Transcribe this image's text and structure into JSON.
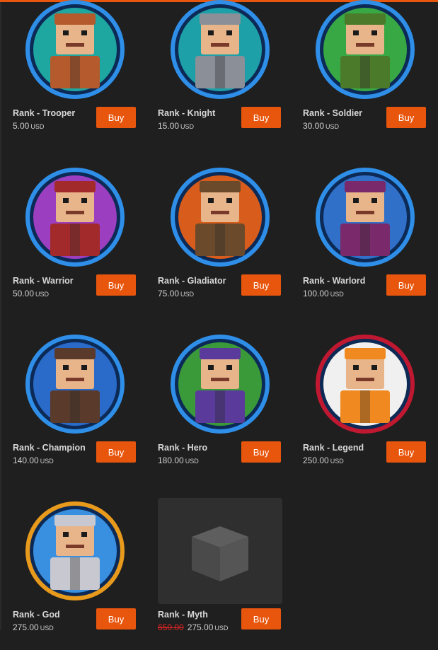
{
  "currency": "USD",
  "buy_label": "Buy",
  "products": [
    {
      "name": "Rank - Trooper",
      "price": "5.00",
      "image": "trooper-avatar",
      "ring": "#2f8fe8",
      "bg": "#1ea6a0",
      "accent": "#b45a2c"
    },
    {
      "name": "Rank - Knight",
      "price": "15.00",
      "image": "knight-avatar",
      "ring": "#2f8fe8",
      "bg": "#1ea0a8",
      "accent": "#8a8f98"
    },
    {
      "name": "Rank - Soldier",
      "price": "30.00",
      "image": "soldier-avatar",
      "ring": "#2f8fe8",
      "bg": "#38a844",
      "accent": "#4a7a2a"
    },
    {
      "name": "Rank - Warrior",
      "price": "50.00",
      "image": "warrior-avatar",
      "ring": "#2f8fe8",
      "bg": "#9b3fc0",
      "accent": "#a32a2a"
    },
    {
      "name": "Rank - Gladiator",
      "price": "75.00",
      "image": "gladiator-avatar",
      "ring": "#2f8fe8",
      "bg": "#d85c1c",
      "accent": "#6a4a2a"
    },
    {
      "name": "Rank - Warlord",
      "price": "100.00",
      "image": "warlord-avatar",
      "ring": "#2f8fe8",
      "bg": "#3070c8",
      "accent": "#7a2a6a"
    },
    {
      "name": "Rank - Champion",
      "price": "140.00",
      "image": "champion-avatar",
      "ring": "#2f8fe8",
      "bg": "#2a6ac8",
      "accent": "#5a3a2a"
    },
    {
      "name": "Rank - Hero",
      "price": "180.00",
      "image": "hero-avatar",
      "ring": "#2f8fe8",
      "bg": "#3a9a3a",
      "accent": "#5a3a9a"
    },
    {
      "name": "Rank - Legend",
      "price": "250.00",
      "image": "legend-avatar",
      "ring": "#c01830",
      "bg": "#f0f0f0",
      "accent": "#f08a20"
    },
    {
      "name": "Rank - God",
      "price": "275.00",
      "image": "god-avatar",
      "ring": "#e89a1c",
      "bg": "#3a90e0",
      "accent": "#c8c8d0"
    },
    {
      "name": "Rank - Myth",
      "price": "275.00",
      "old_price": "650.00",
      "image": "placeholder-box",
      "placeholder": true
    }
  ]
}
